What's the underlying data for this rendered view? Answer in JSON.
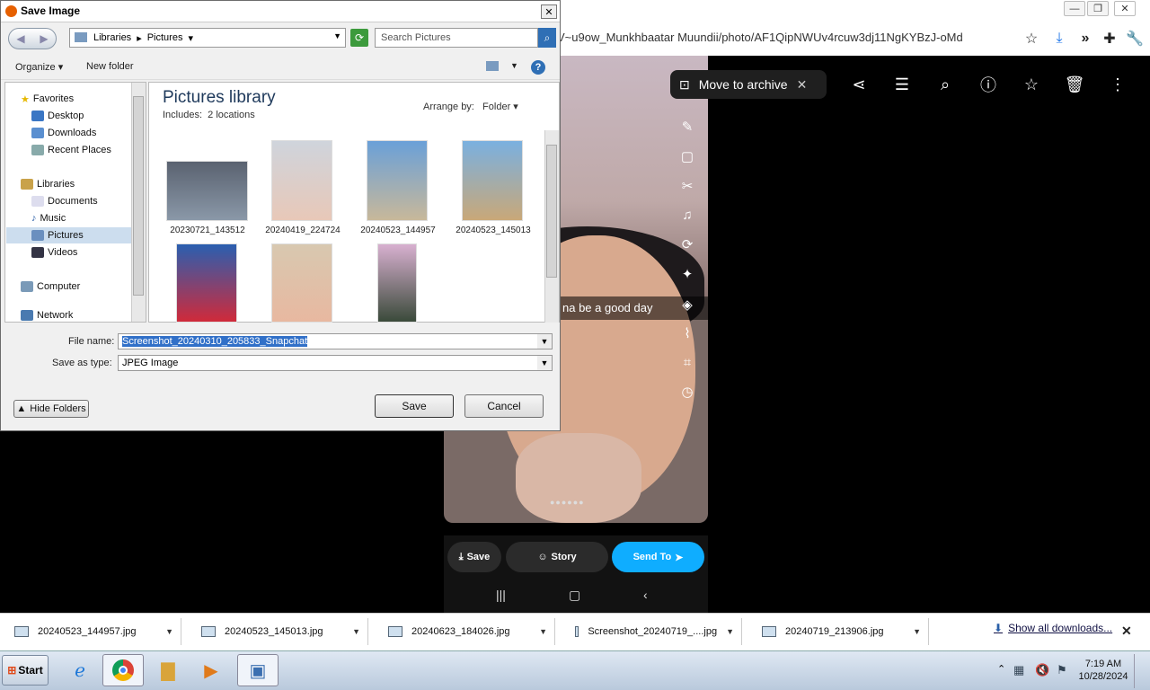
{
  "browser": {
    "url_fragment": "V~u9ow_Munkhbaatar Muundii/photo/AF1QipNWUv4rcuw3dj11NgKYBzJ-oMd",
    "window_buttons": [
      "—",
      "❐",
      "✕"
    ]
  },
  "photos": {
    "archive_label": "Move to archive",
    "caption_text": "na be a good day",
    "snapchat": {
      "save_label": "Save",
      "story_label": "Story",
      "send_label": "Send To"
    }
  },
  "dialog": {
    "title": "Save Image",
    "breadcrumb": [
      "Libraries",
      "Pictures"
    ],
    "search_placeholder": "Search Pictures",
    "organize_label": "Organize",
    "new_folder_label": "New folder",
    "library_title": "Pictures library",
    "includes_label": "Includes:",
    "includes_value": "2 locations",
    "arrange_label": "Arrange by:",
    "arrange_value": "Folder",
    "nav": {
      "favorites": "Favorites",
      "desktop": "Desktop",
      "downloads": "Downloads",
      "recent": "Recent Places",
      "libraries": "Libraries",
      "documents": "Documents",
      "music": "Music",
      "pictures": "Pictures",
      "videos": "Videos",
      "computer": "Computer",
      "network": "Network"
    },
    "files": [
      {
        "name": "20230721_143512"
      },
      {
        "name": "20240419_224724"
      },
      {
        "name": "20240523_144957"
      },
      {
        "name": "20240523_145013"
      }
    ],
    "file_name_label": "File name:",
    "file_name_value": "Screenshot_20240310_205833_Snapchat",
    "save_type_label": "Save as type:",
    "save_type_value": "JPEG Image",
    "hide_folders_label": "Hide Folders",
    "save_label": "Save",
    "cancel_label": "Cancel"
  },
  "downloads": {
    "items": [
      "20240523_144957.jpg",
      "20240523_145013.jpg",
      "20240623_184026.jpg",
      "Screenshot_20240719_....jpg",
      "20240719_213906.jpg"
    ],
    "show_all": "Show all downloads..."
  },
  "taskbar": {
    "start_label": "Start",
    "time": "7:19 AM",
    "date": "10/28/2024"
  }
}
